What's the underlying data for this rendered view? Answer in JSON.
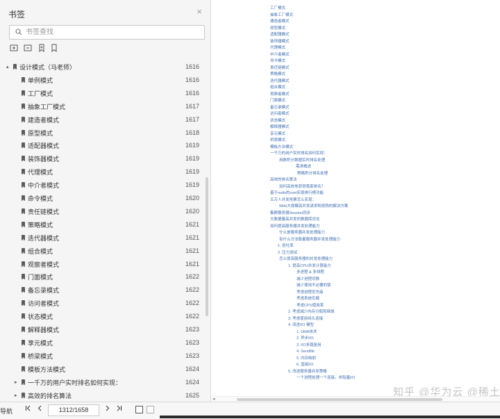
{
  "panel": {
    "title": "书签",
    "search_placeholder": "书签查找",
    "close_glyph": "×",
    "tree": [
      {
        "label": "设计模式（马老师）",
        "page": "1616",
        "level": 0,
        "expander": "▴"
      },
      {
        "label": "单例模式",
        "page": "1616",
        "level": 1
      },
      {
        "label": "工厂模式",
        "page": "1616",
        "level": 1
      },
      {
        "label": "抽象工厂模式",
        "page": "1617",
        "level": 1
      },
      {
        "label": "建造者模式",
        "page": "1617",
        "level": 1
      },
      {
        "label": "原型模式",
        "page": "1618",
        "level": 1
      },
      {
        "label": "适配器模式",
        "page": "1619",
        "level": 1
      },
      {
        "label": "装饰器模式",
        "page": "1619",
        "level": 1
      },
      {
        "label": "代理模式",
        "page": "1619",
        "level": 1
      },
      {
        "label": "中介者模式",
        "page": "1619",
        "level": 1
      },
      {
        "label": "命令模式",
        "page": "1620",
        "level": 1
      },
      {
        "label": "责任链模式",
        "page": "1620",
        "level": 1
      },
      {
        "label": "策略模式",
        "page": "1621",
        "level": 1
      },
      {
        "label": "迭代器模式",
        "page": "1621",
        "level": 1
      },
      {
        "label": "组合模式",
        "page": "1621",
        "level": 1
      },
      {
        "label": "观察者模式",
        "page": "1621",
        "level": 1
      },
      {
        "label": "门面模式",
        "page": "1622",
        "level": 1
      },
      {
        "label": "备忘录模式",
        "page": "1622",
        "level": 1
      },
      {
        "label": "访问者模式",
        "page": "1622",
        "level": 1
      },
      {
        "label": "状态模式",
        "page": "1622",
        "level": 1
      },
      {
        "label": "解释器模式",
        "page": "1623",
        "level": 1
      },
      {
        "label": "享元模式",
        "page": "1623",
        "level": 1
      },
      {
        "label": "桥梁模式",
        "page": "1623",
        "level": 1
      },
      {
        "label": "模板方法模式",
        "page": "1624",
        "level": 1
      },
      {
        "label": "一千万的用户实时排名如何实现：",
        "page": "1624",
        "level": 0,
        "expander": "▸"
      },
      {
        "label": "高效的排名算法",
        "page": "1625",
        "level": 0,
        "expander": "▸"
      }
    ]
  },
  "document": {
    "lines": [
      {
        "text": "工厂模式",
        "indent": 0
      },
      {
        "text": "抽象工厂模式",
        "indent": 0
      },
      {
        "text": "建造者模式",
        "indent": 0
      },
      {
        "text": "原型模式",
        "indent": 0
      },
      {
        "text": "适配器模式",
        "indent": 0
      },
      {
        "text": "装饰器模式",
        "indent": 0
      },
      {
        "text": "代理模式",
        "indent": 0
      },
      {
        "text": "中介者模式",
        "indent": 0
      },
      {
        "text": "命令模式",
        "indent": 0
      },
      {
        "text": "责任链模式",
        "indent": 0
      },
      {
        "text": "策略模式",
        "indent": 0
      },
      {
        "text": "迭代器模式",
        "indent": 0
      },
      {
        "text": "组合模式",
        "indent": 0
      },
      {
        "text": "观察者模式",
        "indent": 0
      },
      {
        "text": "门面模式",
        "indent": 0
      },
      {
        "text": "备忘录模式",
        "indent": 0
      },
      {
        "text": "访问者模式",
        "indent": 0
      },
      {
        "text": "状态模式",
        "indent": 0
      },
      {
        "text": "解释器模式",
        "indent": 0
      },
      {
        "text": "享元模式",
        "indent": 0
      },
      {
        "text": "桥梁模式",
        "indent": 0
      },
      {
        "text": "模板方法模式",
        "indent": 0
      },
      {
        "text": "一千万的用户实时排名如何实现：",
        "indent": 0
      },
      {
        "text": "用数积分数据实时排名处理",
        "indent": 1
      },
      {
        "text": "需求概述",
        "indent": 2
      },
      {
        "text": "策略积分排名处理",
        "indent": 3
      },
      {
        "text": "高效的排名算法",
        "indent": 0
      },
      {
        "text": "如何高效地获得我家排名？",
        "indent": 1
      },
      {
        "text": "基于redis的zset实现排行榜功能",
        "indent": 0
      },
      {
        "text": "五万人并发抢票怎么实现：",
        "indent": 0
      },
      {
        "text": "Web大规模高并发请求和抢购的解决方案",
        "indent": 1
      },
      {
        "text": "集群服务器Session同步",
        "indent": 0
      },
      {
        "text": "大数据量高并发的数据库优化",
        "indent": 0
      },
      {
        "text": "如何提高服务器并发处理能力",
        "indent": 0
      },
      {
        "text": "什么是服务器并发处理能力",
        "indent": 1
      },
      {
        "text": "有什么方法衡量服务器并发处理能力",
        "indent": 1
      },
      {
        "text": "1. 吞吐率",
        "indent": 2
      },
      {
        "text": "2. 压力测试",
        "indent": 2
      },
      {
        "text": "怎么提高服务器的并发处理能力",
        "indent": 1
      },
      {
        "text": "1. 提高CPU并发计算能力",
        "indent": 2
      },
      {
        "text": "多进程 & 多线程",
        "indent": 3
      },
      {
        "text": "减少进程切换",
        "indent": 3
      },
      {
        "text": "减少使用不必要的锁",
        "indent": 3
      },
      {
        "text": "考虑进程优先级",
        "indent": 3
      },
      {
        "text": "考虑系统负载",
        "indent": 3
      },
      {
        "text": "考虑CPU使用率",
        "indent": 3
      },
      {
        "text": "2. 考虑减少内存分配和释放",
        "indent": 2
      },
      {
        "text": "3. 考虑使用持久连接",
        "indent": 2
      },
      {
        "text": "4. 改进I/O 模型",
        "indent": 2
      },
      {
        "text": "1. DMA技术",
        "indent": 3
      },
      {
        "text": "2. 异步I/O",
        "indent": 3
      },
      {
        "text": "3. I/O多路复用",
        "indent": 3
      },
      {
        "text": "4. Sendfile",
        "indent": 3
      },
      {
        "text": "5. 内存映射",
        "indent": 3
      },
      {
        "text": "6. 直接I/O",
        "indent": 3
      },
      {
        "text": "5. 改进服务器并发策略",
        "indent": 2
      },
      {
        "text": "一个进程处理一个连接，非阻塞I/O",
        "indent": 3
      }
    ],
    "watermark": "知乎 @华为云 @稀土掘金技术社区"
  },
  "navbar": {
    "label": "导航",
    "first_glyph": "K",
    "prev_glyph": "<",
    "page_indicator": "1312/1658",
    "next_glyph": ">",
    "last_glyph": "K"
  }
}
